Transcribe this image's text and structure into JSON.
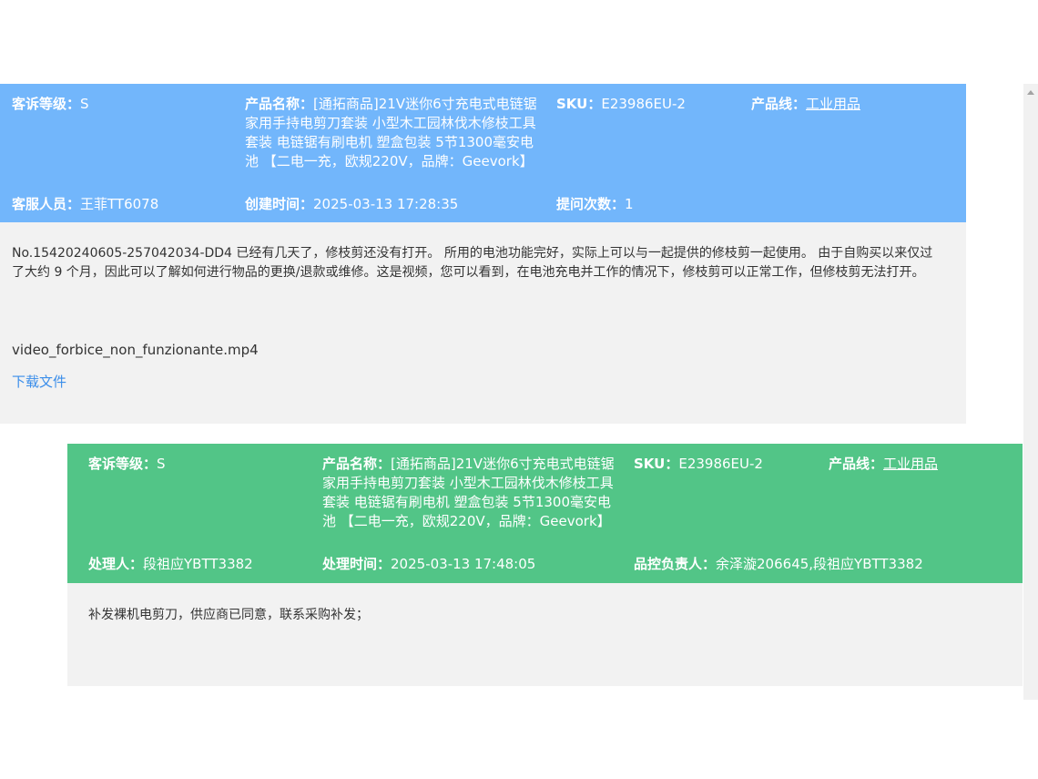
{
  "complaint": {
    "level_label": "客诉等级：",
    "level_value": "S",
    "product_label": "产品名称：",
    "product_value": "[通拓商品]21V迷你6寸充电式电链锯家用手持电剪刀套装 小型木工园林伐木修枝工具套装 电链锯有刷电机 塑盒包装 5节1300毫安电池 【二电一充，欧规220V，品牌：Geevork】",
    "sku_label": "SKU：",
    "sku_value": "E23986EU-2",
    "line_label": "产品线：",
    "line_value": "工业用品",
    "agent_label": "客服人员：",
    "agent_value": "王菲TT6078",
    "created_label": "创建时间：",
    "created_value": "2025-03-13 17:28:35",
    "count_label": "提问次数：",
    "count_value": "1",
    "description": "No.15420240605-257042034-DD4 已经有几天了，修枝剪还没有打开。 所用的电池功能完好，实际上可以与一起提供的修枝剪一起使用。 由于自购买以来仅过了大约 9 个月，因此可以了解如何进行物品的更换/退款或维修。这是视频，您可以看到，在电池充电并工作的情况下，修枝剪可以正常工作，但修枝剪无法打开。",
    "attachment_name": "video_forbice_non_funzionante.mp4",
    "download_label": "下载文件"
  },
  "resolution": {
    "level_label": "客诉等级：",
    "level_value": "S",
    "product_label": "产品名称：",
    "product_value": "[通拓商品]21V迷你6寸充电式电链锯家用手持电剪刀套装 小型木工园林伐木修枝工具套装 电链锯有刷电机 塑盒包装 5节1300毫安电池 【二电一充，欧规220V，品牌：Geevork】",
    "sku_label": "SKU：",
    "sku_value": "E23986EU-2",
    "line_label": "产品线：",
    "line_value": "工业用品",
    "handler_label": "处理人：",
    "handler_value": "段祖应YBTT3382",
    "handled_label": "处理时间：",
    "handled_value": "2025-03-13 17:48:05",
    "qc_label": "品控负责人：",
    "qc_value": "余泽漩206645,段祖应YBTT3382",
    "reply": "补发裸机电剪刀，供应商已同意，联系采购补发；"
  },
  "colors": {
    "complaint_header": "#72b6fb",
    "resolution_header": "#52c587",
    "body_bg": "#f2f2f2",
    "link": "#3b8eea"
  }
}
